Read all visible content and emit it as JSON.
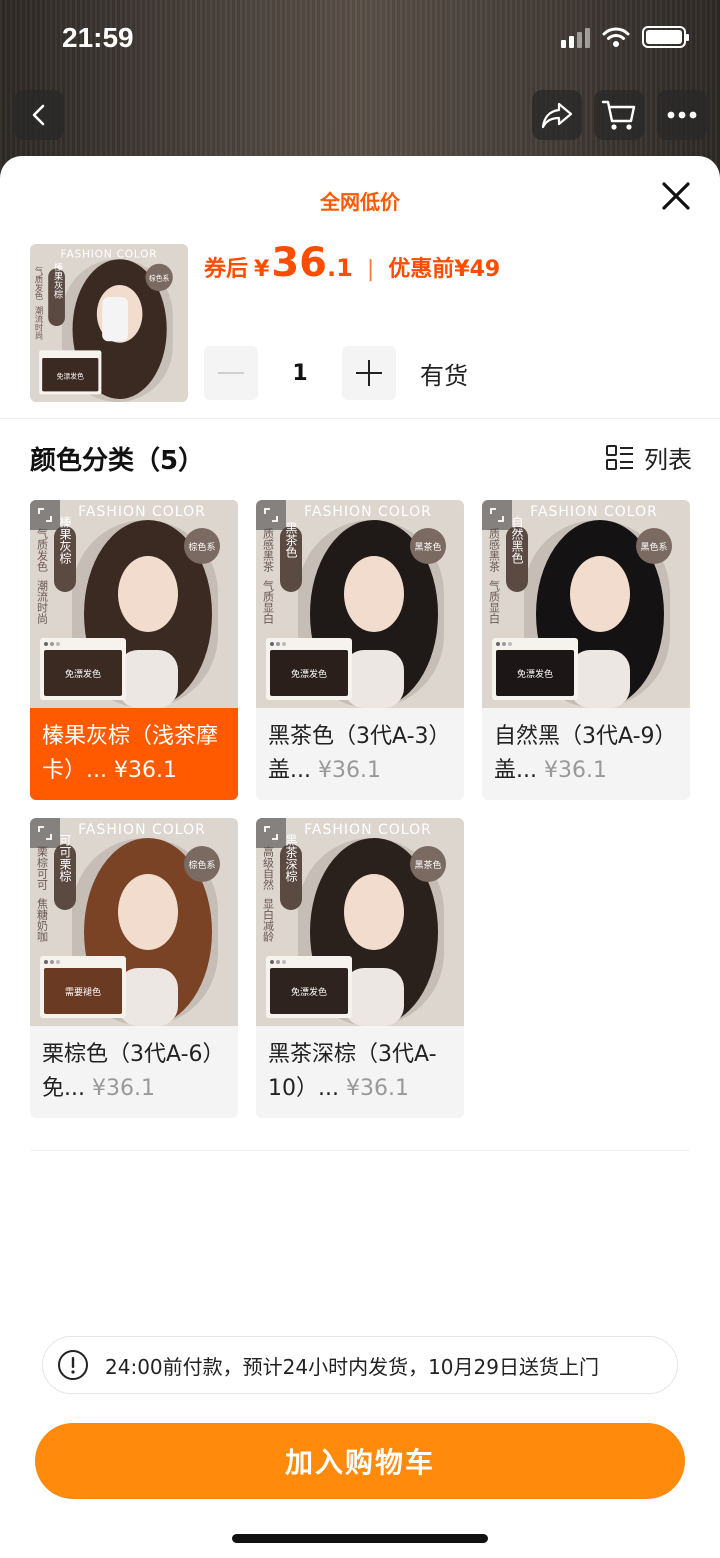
{
  "status_bar": {
    "time": "21:59"
  },
  "header": {
    "back_icon": "chevron-left-icon",
    "share_icon": "share-icon",
    "cart_icon": "cart-icon",
    "more_icon": "more-icon"
  },
  "sheet": {
    "promo_title": "全网低价",
    "price": {
      "after_coupon_label": "券后",
      "currency": "¥",
      "after_coupon_int": "36",
      "after_coupon_dec": ".1",
      "separator": "|",
      "before_label": "优惠前",
      "before_value": "¥49"
    },
    "quantity": {
      "value": "1",
      "stock": "有货"
    },
    "section_title": "颜色分类（5）",
    "view_toggle_label": "列表",
    "thumb_text": {
      "brand": "FASHION COLOR",
      "system": "棕色系",
      "name": "榛果灰棕",
      "slogan1": "气质发色",
      "slogan2": "潮流时尚",
      "swatch": "免漂发色"
    }
  },
  "variants": [
    {
      "title": "榛果灰棕（浅茶摩卡）...",
      "price": "¥36.1",
      "selected": true,
      "tag": "榛果灰棕",
      "slogan1": "气质发色",
      "slogan2": "潮流时尚",
      "system": "棕色系",
      "swatch": "免漂发色",
      "brand": "FASHION COLOR",
      "hair_color": "#3a2a22",
      "swatch_color": "#3b2a22"
    },
    {
      "title": "黑茶色（3代A-3）盖...",
      "price": "¥36.1",
      "selected": false,
      "tag": "黑茶色",
      "slogan1": "质感黑茶",
      "slogan2": "气质显白",
      "system": "黑茶色",
      "swatch": "免漂发色",
      "brand": "FASHION COLOR",
      "hair_color": "#1f1a18",
      "swatch_color": "#2a1f1b"
    },
    {
      "title": "自然黑（3代A-9）盖...",
      "price": "¥36.1",
      "selected": false,
      "tag": "自然黑色",
      "slogan1": "质感黑茶",
      "slogan2": "气质显白",
      "system": "黑色系",
      "swatch": "免漂发色",
      "brand": "FASHION COLOR",
      "hair_color": "#141212",
      "swatch_color": "#1c1716"
    },
    {
      "title": "栗棕色（3代A-6）免...",
      "price": "¥36.1",
      "selected": false,
      "tag": "可可栗棕",
      "slogan1": "栗棕可可",
      "slogan2": "焦糖奶咖",
      "system": "棕色系",
      "swatch": "需要褪色",
      "brand": "FASHION COLOR",
      "hair_color": "#7a4326",
      "swatch_color": "#6a3a22"
    },
    {
      "title": "黑茶深棕（3代A-10）...",
      "price": "¥36.1",
      "selected": false,
      "tag": "黑茶深棕",
      "slogan1": "高级自然",
      "slogan2": "显白减龄",
      "system": "黑茶色",
      "swatch": "免漂发色",
      "brand": "FASHION COLOR",
      "hair_color": "#2a211d",
      "swatch_color": "#2e231e"
    }
  ],
  "notice": {
    "icon": "exclamation-icon",
    "text": "24:00前付款，预计24小时内发货，10月29日送货上门"
  },
  "add_to_cart": {
    "label": "加入购物车"
  },
  "colors": {
    "accent": "#ff5a00",
    "button": "#ff8a0c",
    "price": "#ff4d00"
  }
}
